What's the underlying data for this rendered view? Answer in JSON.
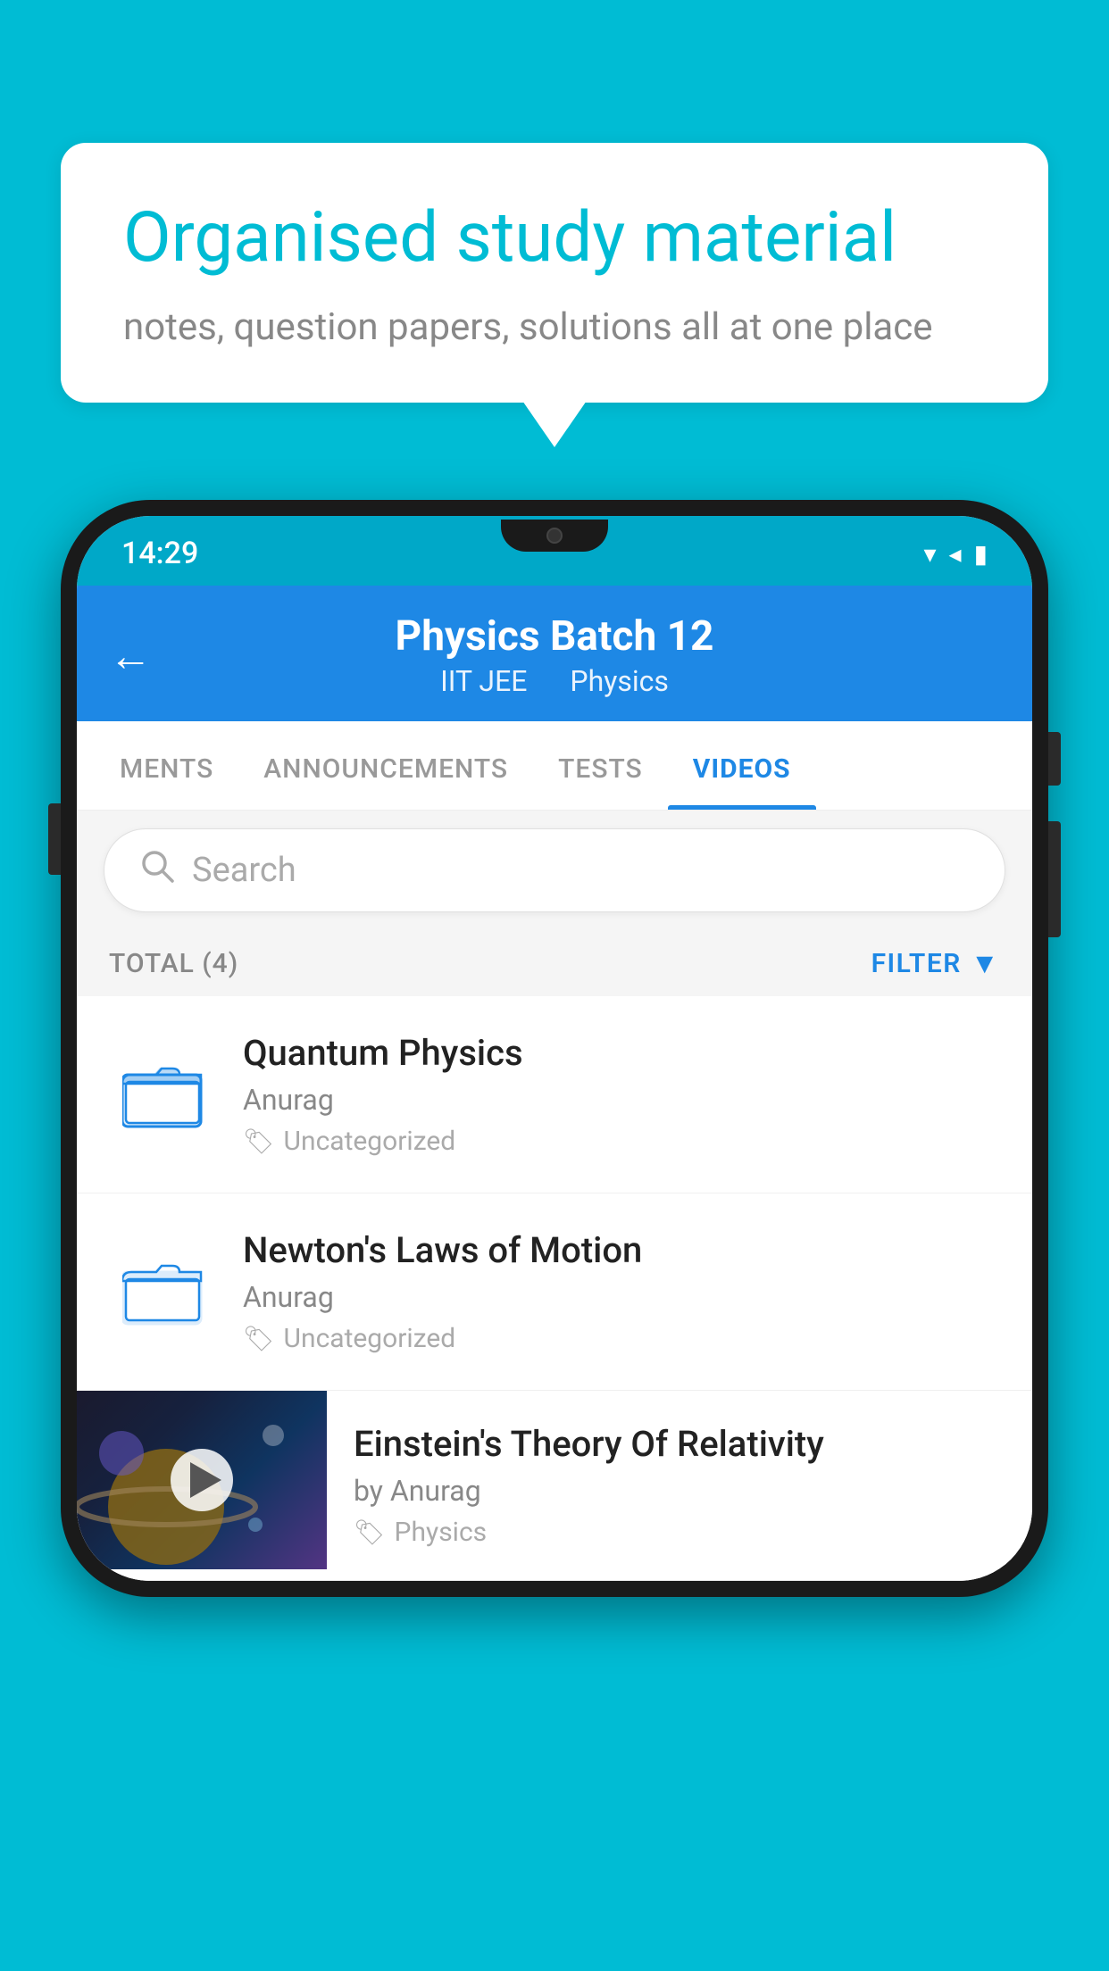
{
  "bubble": {
    "title": "Organised study material",
    "subtitle": "notes, question papers, solutions all at one place"
  },
  "status_bar": {
    "time": "14:29",
    "icons": [
      "▼",
      "◀",
      "▮"
    ]
  },
  "header": {
    "back_label": "←",
    "title": "Physics Batch 12",
    "subtitle_1": "IIT JEE",
    "subtitle_2": "Physics"
  },
  "tabs": [
    {
      "label": "MENTS",
      "active": false
    },
    {
      "label": "ANNOUNCEMENTS",
      "active": false
    },
    {
      "label": "TESTS",
      "active": false
    },
    {
      "label": "VIDEOS",
      "active": true
    }
  ],
  "search": {
    "placeholder": "Search"
  },
  "filter": {
    "total_label": "TOTAL (4)",
    "filter_label": "FILTER"
  },
  "videos": [
    {
      "id": 1,
      "title": "Quantum Physics",
      "author": "Anurag",
      "tag": "Uncategorized",
      "type": "folder",
      "has_thumbnail": false
    },
    {
      "id": 2,
      "title": "Newton's Laws of Motion",
      "author": "Anurag",
      "tag": "Uncategorized",
      "type": "folder",
      "has_thumbnail": false
    },
    {
      "id": 3,
      "title": "Einstein's Theory Of Relativity",
      "author": "by Anurag",
      "tag": "Physics",
      "type": "video",
      "has_thumbnail": true
    }
  ]
}
